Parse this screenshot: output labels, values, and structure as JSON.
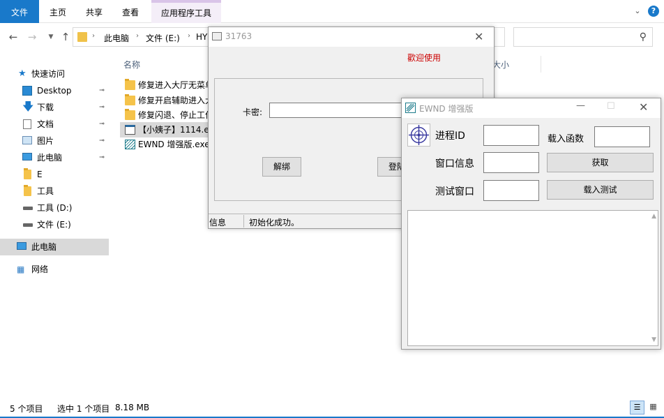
{
  "ribbon": {
    "tabs": [
      "文件",
      "主页",
      "共享",
      "查看",
      "应用程序工具"
    ]
  },
  "address": {
    "crumbs": [
      "此电脑",
      "文件 (E:)",
      "HY"
    ]
  },
  "nav": {
    "items": [
      {
        "label": "快速访问",
        "icon": "star-icon"
      },
      {
        "label": "Desktop",
        "icon": "desktop-icon",
        "pinned": true
      },
      {
        "label": "下载",
        "icon": "download-icon",
        "pinned": true
      },
      {
        "label": "文档",
        "icon": "document-icon",
        "pinned": true
      },
      {
        "label": "图片",
        "icon": "picture-icon",
        "pinned": true
      },
      {
        "label": "此电脑",
        "icon": "computer-icon",
        "pinned": true
      },
      {
        "label": "E",
        "icon": "folder-icon"
      },
      {
        "label": "工具",
        "icon": "folder-icon"
      },
      {
        "label": "工具 (D:)",
        "icon": "drive-icon"
      },
      {
        "label": "文件 (E:)",
        "icon": "drive-icon"
      },
      {
        "label": "此电脑",
        "icon": "computer-icon"
      },
      {
        "label": "网络",
        "icon": "network-icon"
      }
    ]
  },
  "filelist": {
    "col_name": "名称",
    "col_size": "大小",
    "files": [
      {
        "name": "修复进入大厅无菜单",
        "icon": "folder-icon"
      },
      {
        "name": "修复开启辅助进入大",
        "icon": "folder-icon"
      },
      {
        "name": "修复闪退、停止工作",
        "icon": "folder-icon"
      },
      {
        "name": "【小姨子】1114.exe",
        "icon": "exe-icon"
      },
      {
        "name": "EWND 增强版.exe",
        "icon": "ewnd-app-icon"
      }
    ]
  },
  "status": {
    "count": "5 个项目",
    "selected": "选中 1 个项目",
    "size": "8.18 MB"
  },
  "dialog1": {
    "title": "31763",
    "welcome": "歡迎使用",
    "card_label": "卡密:",
    "unbind": "解绑",
    "login": "登陆",
    "status_label": "信息",
    "status_msg": "初始化成功。"
  },
  "dialog2": {
    "title": "EWND 增强版",
    "pid_label": "进程ID",
    "load_func_label": "载入函数",
    "win_info_label": "窗口信息",
    "get_btn": "获取",
    "test_win_label": "测试窗口",
    "load_test_btn": "载入测试"
  }
}
